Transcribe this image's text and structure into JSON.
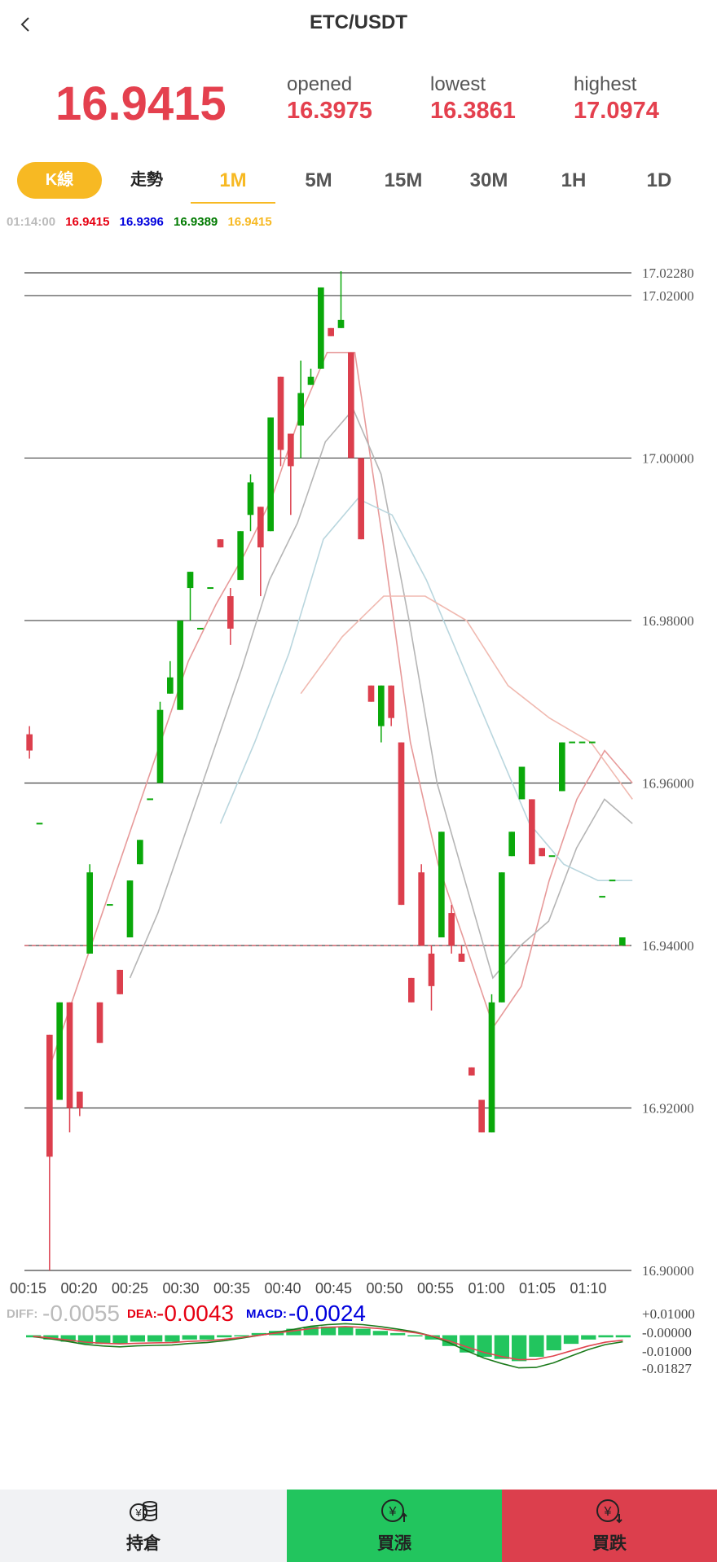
{
  "header": {
    "title": "ETC/USDT",
    "back_icon": "chevron-left-icon"
  },
  "ticker": {
    "last_price": "16.9415",
    "opened_label": "opened",
    "opened_value": "16.3975",
    "lowest_label": "lowest",
    "lowest_value": "16.3861",
    "highest_label": "highest",
    "highest_value": "17.0974"
  },
  "tabs": {
    "kline_label": "K線",
    "trend_label": "走勢",
    "intervals": [
      "1M",
      "5M",
      "15M",
      "30M",
      "1H",
      "1D"
    ],
    "active_interval": "1M"
  },
  "ma_info": {
    "time": "01:14:00",
    "v1": "16.9415",
    "v2": "16.9396",
    "v3": "16.9389",
    "v4": "16.9415",
    "colors": [
      "#aaaaaa",
      "#e60012",
      "#0000dd",
      "#007a00",
      "#f7b923"
    ]
  },
  "macd_info": {
    "diff_label": "DIFF:",
    "diff_value": "-0.0055",
    "dea_label": "DEA:",
    "dea_value": "-0.0043",
    "macd_label": "MACD:",
    "macd_value": "-0.0024"
  },
  "chart_data": {
    "type": "candlestick",
    "up_color": "#0aa80a",
    "down_color": "#dc3f4d",
    "ylim": [
      16.9,
      17.0228
    ],
    "price_levels": [
      "17.02280",
      "17.02000",
      "17.00000",
      "16.98000",
      "16.96000",
      "16.94000",
      "16.92000",
      "16.90000"
    ],
    "last_price_line": 16.94,
    "x_labels": [
      "00:15",
      "00:20",
      "00:25",
      "00:30",
      "00:35",
      "00:40",
      "00:45",
      "00:50",
      "00:55",
      "01:00",
      "01:05",
      "01:10"
    ],
    "candles": [
      [
        16.966,
        16.964,
        16.967,
        16.963
      ],
      [
        16.955,
        16.955,
        16.955,
        16.955
      ],
      [
        16.929,
        16.914,
        16.929,
        16.9
      ],
      [
        16.921,
        16.933,
        16.933,
        16.921
      ],
      [
        16.933,
        16.92,
        16.933,
        16.917
      ],
      [
        16.922,
        16.92,
        16.922,
        16.919
      ],
      [
        16.939,
        16.949,
        16.95,
        16.939
      ],
      [
        16.933,
        16.928,
        16.933,
        16.928
      ],
      [
        16.945,
        16.945,
        16.945,
        16.945
      ],
      [
        16.937,
        16.934,
        16.937,
        16.934
      ],
      [
        16.941,
        16.948,
        16.948,
        16.941
      ],
      [
        16.95,
        16.953,
        16.953,
        16.95
      ],
      [
        16.958,
        16.958,
        16.958,
        16.958
      ],
      [
        16.96,
        16.969,
        16.97,
        16.96
      ],
      [
        16.971,
        16.973,
        16.975,
        16.971
      ],
      [
        16.969,
        16.98,
        16.98,
        16.969
      ],
      [
        16.984,
        16.986,
        16.986,
        16.98
      ],
      [
        16.979,
        16.979,
        16.979,
        16.979
      ],
      [
        16.984,
        16.984,
        16.984,
        16.984
      ],
      [
        16.99,
        16.989,
        16.99,
        16.989
      ],
      [
        16.983,
        16.979,
        16.984,
        16.977
      ],
      [
        16.985,
        16.991,
        16.991,
        16.985
      ],
      [
        16.993,
        16.997,
        16.998,
        16.991
      ],
      [
        16.994,
        16.989,
        16.994,
        16.983
      ],
      [
        16.991,
        17.005,
        17.005,
        16.991
      ],
      [
        17.01,
        17.001,
        17.01,
        16.999
      ],
      [
        17.003,
        16.999,
        17.003,
        16.993
      ],
      [
        17.004,
        17.008,
        17.012,
        17.0
      ],
      [
        17.009,
        17.01,
        17.011,
        17.009
      ],
      [
        17.011,
        17.021,
        17.021,
        17.011
      ],
      [
        17.016,
        17.015,
        17.016,
        17.015
      ],
      [
        17.016,
        17.017,
        17.023,
        17.016
      ],
      [
        17.013,
        17.0,
        17.013,
        17.0
      ],
      [
        17.0,
        16.99,
        17.0,
        16.99
      ],
      [
        16.972,
        16.97,
        16.972,
        16.97
      ],
      [
        16.967,
        16.972,
        16.972,
        16.965
      ],
      [
        16.972,
        16.968,
        16.972,
        16.967
      ],
      [
        16.965,
        16.945,
        16.965,
        16.945
      ],
      [
        16.936,
        16.933,
        16.936,
        16.933
      ],
      [
        16.949,
        16.94,
        16.95,
        16.94
      ],
      [
        16.939,
        16.935,
        16.94,
        16.932
      ],
      [
        16.941,
        16.954,
        16.954,
        16.941
      ],
      [
        16.944,
        16.94,
        16.945,
        16.939
      ],
      [
        16.939,
        16.938,
        16.94,
        16.938
      ],
      [
        16.925,
        16.924,
        16.925,
        16.924
      ],
      [
        16.921,
        16.917,
        16.921,
        16.917
      ],
      [
        16.917,
        16.933,
        16.934,
        16.917
      ],
      [
        16.933,
        16.949,
        16.949,
        16.933
      ],
      [
        16.951,
        16.954,
        16.954,
        16.951
      ],
      [
        16.958,
        16.962,
        16.962,
        16.958
      ],
      [
        16.958,
        16.95,
        16.958,
        16.95
      ],
      [
        16.952,
        16.951,
        16.952,
        16.951
      ],
      [
        16.951,
        16.951,
        16.951,
        16.951
      ],
      [
        16.959,
        16.965,
        16.965,
        16.959
      ],
      [
        16.965,
        16.965,
        16.965,
        16.965
      ],
      [
        16.965,
        16.965,
        16.965,
        16.965
      ],
      [
        16.965,
        16.965,
        16.965,
        16.965
      ],
      [
        16.946,
        16.946,
        16.946,
        16.946
      ],
      [
        16.948,
        16.948,
        16.948,
        16.948
      ],
      [
        16.94,
        16.941,
        16.941,
        16.94
      ]
    ],
    "ma_lines": [
      {
        "color": "#e79a9a",
        "values": [
          16.925,
          16.935,
          16.945,
          16.955,
          16.965,
          16.975,
          16.982,
          16.988,
          16.995,
          17.005,
          17.013,
          17.013,
          16.99,
          16.965,
          16.95,
          16.94,
          16.93,
          16.935,
          16.948,
          16.958,
          16.964,
          16.96
        ]
      },
      {
        "color": "#b5b5b5",
        "values": [
          16.936,
          16.944,
          16.954,
          16.964,
          16.974,
          16.985,
          16.992,
          17.002,
          17.006,
          16.998,
          16.98,
          16.96,
          16.948,
          16.936,
          16.94,
          16.943,
          16.952,
          16.958,
          16.955
        ]
      },
      {
        "color": "#b9d6de",
        "values": [
          16.955,
          16.965,
          16.976,
          16.99,
          16.995,
          16.993,
          16.985,
          16.975,
          16.965,
          16.955,
          16.95,
          16.948,
          16.948
        ]
      },
      {
        "color": "#f0b9b0",
        "values": [
          16.971,
          16.978,
          16.983,
          16.983,
          16.98,
          16.972,
          16.968,
          16.965,
          16.958
        ]
      }
    ],
    "macd": {
      "ylim": [
        -0.01827,
        0.01
      ],
      "axis_labels": [
        "+0.01000",
        "-0.00000",
        "-0.01000",
        "-0.01827"
      ],
      "histogram": [
        -0.001,
        -0.002,
        -0.003,
        -0.004,
        -0.004,
        -0.004,
        -0.003,
        -0.003,
        -0.003,
        -0.002,
        -0.002,
        -0.001,
        0.0,
        0.001,
        0.002,
        0.003,
        0.004,
        0.004,
        0.004,
        0.003,
        0.002,
        0.001,
        0.0,
        -0.002,
        -0.005,
        -0.008,
        -0.01,
        -0.011,
        -0.012,
        -0.01,
        -0.007,
        -0.004,
        -0.002,
        -0.001,
        -0.001
      ],
      "diff_color": "#1b7a1b",
      "dea_color": "#e0454f",
      "histogram_color": "#22c55e"
    }
  },
  "bottom_bar": {
    "position_label": "持倉",
    "buy_up_label": "買漲",
    "buy_down_label": "買跌"
  }
}
